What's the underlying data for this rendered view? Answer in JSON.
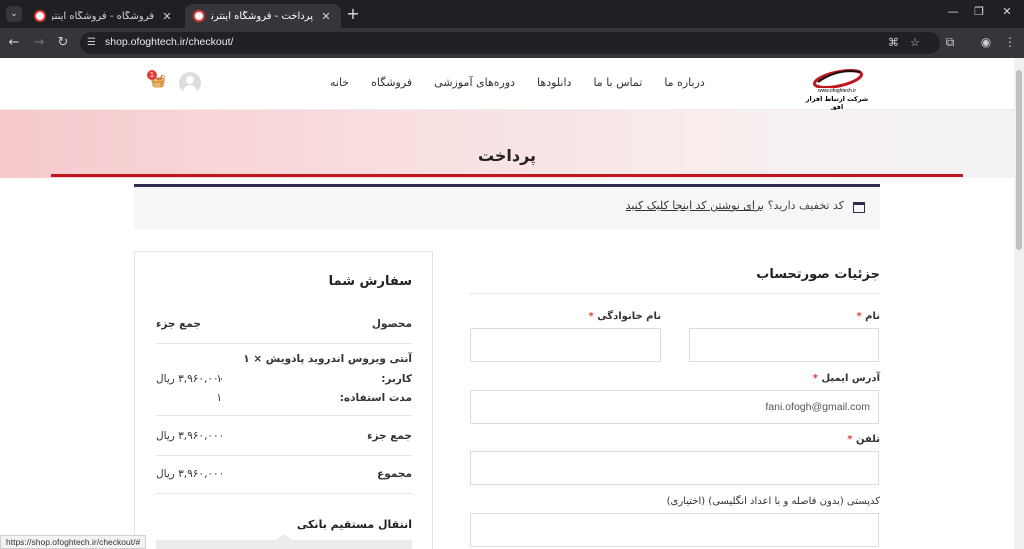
{
  "browser": {
    "tabs": [
      {
        "title": "فروشگاه - فروشگاه اینترنتی ارتباط افزار"
      },
      {
        "title": "پرداخت - فروشگاه اینترنتی ارتباط افزار"
      }
    ],
    "active_tab": 1,
    "url": "shop.ofoghtech.ir/checkout/",
    "status_url": "https://shop.ofoghtech.ir/checkout/#"
  },
  "site": {
    "logo_domain": "www.ofoghtech.ir",
    "logo_name": "شرکت ارتباط افزار افق",
    "brand_color": "#c0161d",
    "nav": [
      "خانه",
      "فروشگاه",
      "دوره‌های آموزشی",
      "دانلودها",
      "تماس با ما",
      "درباره ما"
    ],
    "cart_count": "1"
  },
  "hero": {
    "title": "پرداخت"
  },
  "coupon": {
    "prompt": "کد تخفیف دارید؟",
    "link": "برای نوشتن کد اینجا کلیک کنید"
  },
  "order": {
    "heading": "سفارش شما",
    "col_product": "محصول",
    "col_subtotal": "جمع جزء",
    "item_name": "آنتی ویروس اندروید پادویش × ۱",
    "meta": [
      {
        "label": "کاربر:",
        "value": "۱"
      },
      {
        "label": "مدت استفاده:",
        "value": "۱"
      }
    ],
    "item_price": "۳,۹۶۰,۰۰۰ ریال",
    "subtotal_label": "جمع جزء",
    "subtotal_value": "۳,۹۶۰,۰۰۰ ریال",
    "total_label": "مجموع",
    "total_value": "۳,۹۶۰,۰۰۰ ریال",
    "payment_method": "انتقال مستقیم بانکی"
  },
  "billing": {
    "heading": "جزئیات صورتحساب",
    "first_name_label": "نام",
    "last_name_label": "نام خانوادگی",
    "email_label": "آدرس ایمیل",
    "email_value": "fani.ofogh@gmail.com",
    "phone_label": "تلفن",
    "postcode_label": "کدپستی (بدون فاصله و با اعداد انگلیسی) (اختیاری)",
    "required_mark": "*"
  }
}
